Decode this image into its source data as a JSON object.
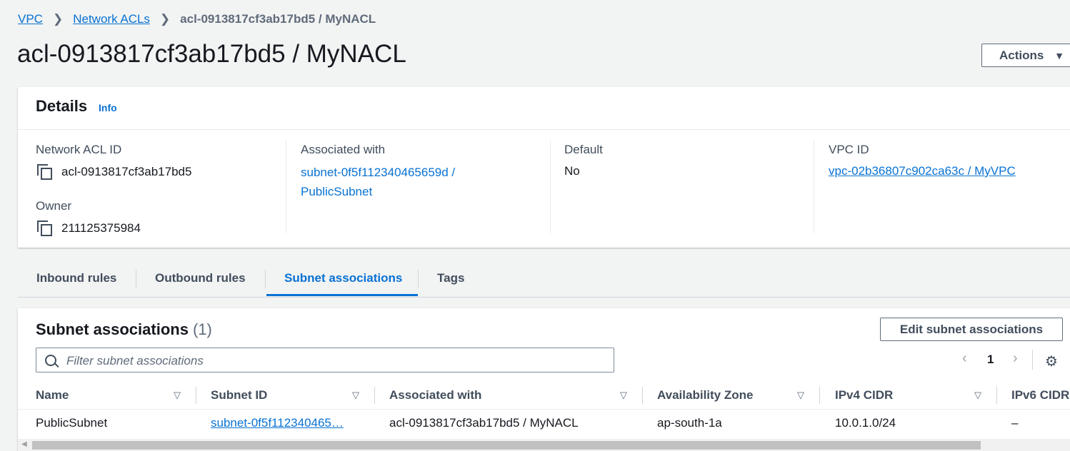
{
  "breadcrumb": {
    "items": [
      "VPC",
      "Network ACLs"
    ],
    "current": "acl-0913817cf3ab17bd5 / MyNACL"
  },
  "page_title": "acl-0913817cf3ab17bd5 / MyNACL",
  "actions_label": "Actions",
  "details": {
    "heading": "Details",
    "info": "Info",
    "network_acl_id_label": "Network ACL ID",
    "network_acl_id": "acl-0913817cf3ab17bd5",
    "owner_label": "Owner",
    "owner": "211125375984",
    "associated_with_label": "Associated with",
    "associated_with_line1": "subnet-0f5f112340465659d /",
    "associated_with_line2": "PublicSubnet",
    "default_label": "Default",
    "default": "No",
    "vpc_id_label": "VPC ID",
    "vpc_id": "vpc-02b36807c902ca63c / MyVPC"
  },
  "tabs": [
    "Inbound rules",
    "Outbound rules",
    "Subnet associations",
    "Tags"
  ],
  "subnets": {
    "title": "Subnet associations",
    "count": "(1)",
    "edit_label": "Edit subnet associations",
    "filter_placeholder": "Filter subnet associations",
    "page": "1",
    "columns": [
      "Name",
      "Subnet ID",
      "Associated with",
      "Availability Zone",
      "IPv4 CIDR",
      "IPv6 CIDR"
    ],
    "rows": [
      {
        "name": "PublicSubnet",
        "subnet_id": "subnet-0f5f112340465…",
        "associated_with": "acl-0913817cf3ab17bd5 / MyNACL",
        "az": "ap-south-1a",
        "ipv4": "10.0.1.0/24",
        "ipv6": "–"
      }
    ]
  },
  "icons": {
    "copy": "copy-icon",
    "search": "search-icon",
    "settings": "gear-icon",
    "sort": "sort-caret-icon"
  },
  "colors": {
    "link": "#0972d3",
    "text": "#16191f",
    "bg": "#f2f3f3"
  }
}
